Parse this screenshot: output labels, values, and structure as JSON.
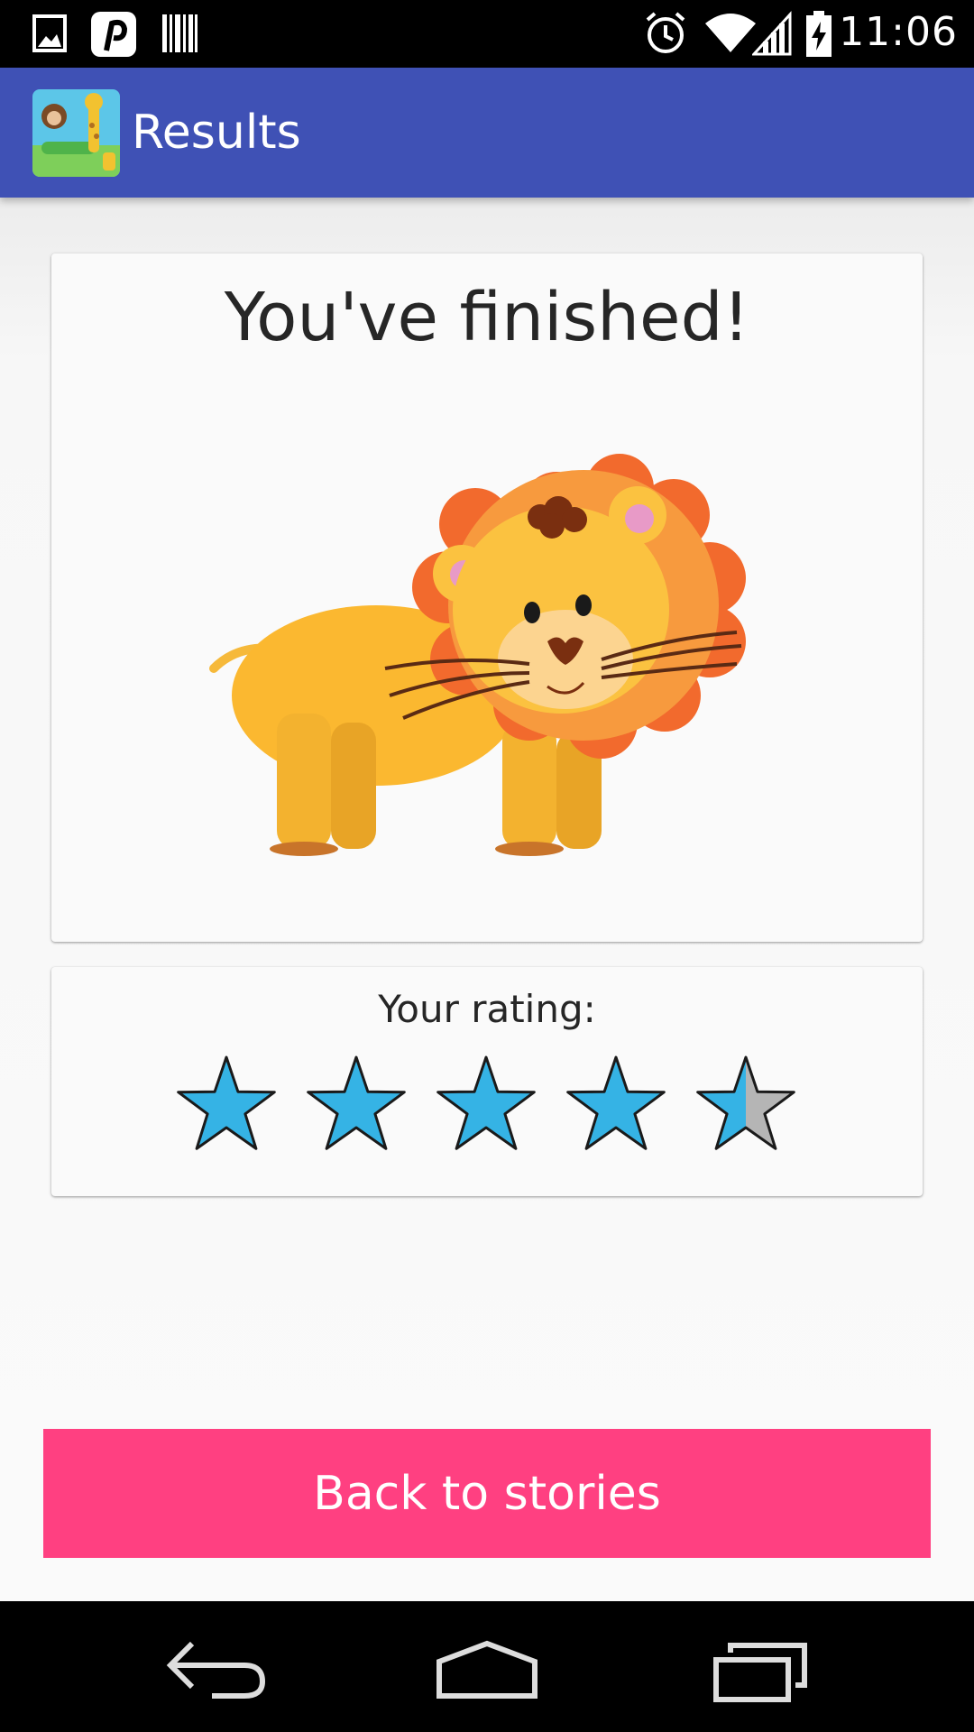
{
  "status_bar": {
    "time": "11:06",
    "left_icons": [
      "image-icon",
      "pinterest-icon",
      "barcode-icon"
    ],
    "right_icons": [
      "alarm-icon",
      "wifi-icon",
      "signal-icon",
      "battery-charging-icon"
    ]
  },
  "app_bar": {
    "title": "Results",
    "logo": "jungle-animals-logo"
  },
  "finished_card": {
    "title": "You've finished!",
    "image": "lion-illustration"
  },
  "rating_card": {
    "label": "Your rating:",
    "rating": 4.5,
    "max": 5,
    "star_color": "#35B3E5",
    "empty_color": "#B5B5B5"
  },
  "actions": {
    "back_label": "Back to stories",
    "back_color": "#FF4081"
  },
  "nav_bar": {
    "buttons": [
      "back-icon",
      "home-icon",
      "recents-icon"
    ]
  }
}
